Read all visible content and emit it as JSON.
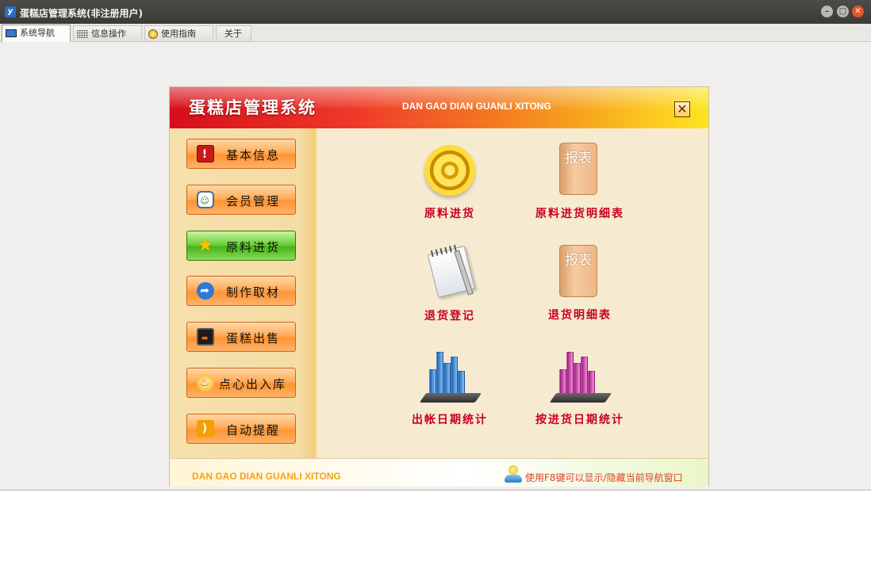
{
  "window": {
    "title": "蛋糕店管理系统(非注册用户)",
    "app_icon": "y",
    "controls": {
      "minimize": "–",
      "maximize": "□",
      "close": "✕"
    }
  },
  "tabs": [
    {
      "label": "系统导航",
      "icon": "monitor-icon",
      "active": true
    },
    {
      "label": "信息操作",
      "icon": "grid-icon",
      "active": false
    },
    {
      "label": "使用指南",
      "icon": "help-icon",
      "active": false
    },
    {
      "label": "关于",
      "icon": "",
      "active": false
    }
  ],
  "panel": {
    "title": "蛋糕店管理系统",
    "subtitle": "DAN GAO DIAN GUANLI XITONG",
    "close_label": "✕"
  },
  "sidebar": {
    "items": [
      {
        "label": "基本信息",
        "icon": "info-icon",
        "glyph": "!"
      },
      {
        "label": "会员管理",
        "icon": "member-card-icon",
        "glyph": "☺"
      },
      {
        "label": "原料进货",
        "icon": "star-icon",
        "glyph": "★",
        "active": true
      },
      {
        "label": "制作取材",
        "icon": "arrow-icon",
        "glyph": "➦"
      },
      {
        "label": "蛋糕出售",
        "icon": "monitor-icon",
        "glyph": "▬"
      },
      {
        "label": "点心出入库",
        "icon": "fire-icon",
        "glyph": "♨"
      },
      {
        "label": "自动提醒",
        "icon": "rss-icon",
        "glyph": ")"
      }
    ]
  },
  "content": {
    "items": [
      {
        "label": "原料进货",
        "icon": "target-icon"
      },
      {
        "label": "原料进货明细表",
        "icon": "report-icon",
        "icon_text": "报表"
      },
      {
        "label": "退货登记",
        "icon": "notepad-icon"
      },
      {
        "label": "退货明细表",
        "icon": "report-icon",
        "icon_text": "报表"
      },
      {
        "label": "出帐日期统计",
        "icon": "blue-bar-chart-icon"
      },
      {
        "label": "按进货日期统计",
        "icon": "pink-bar-chart-icon"
      }
    ]
  },
  "footer": {
    "left_text": "DAN GAO DIAN GUANLI XITONG",
    "hint": "使用F8键可以显示/隐藏当前导航窗口",
    "hint_icon": "user-icon"
  },
  "colors": {
    "banner_red": "#d70d1a",
    "banner_yellow": "#fde51f",
    "label_red": "#c7001e",
    "button_orange": "#ff9432",
    "button_green": "#46b41b",
    "blue_bars": "#3a8fe0",
    "pink_bars": "#d63bb0"
  }
}
